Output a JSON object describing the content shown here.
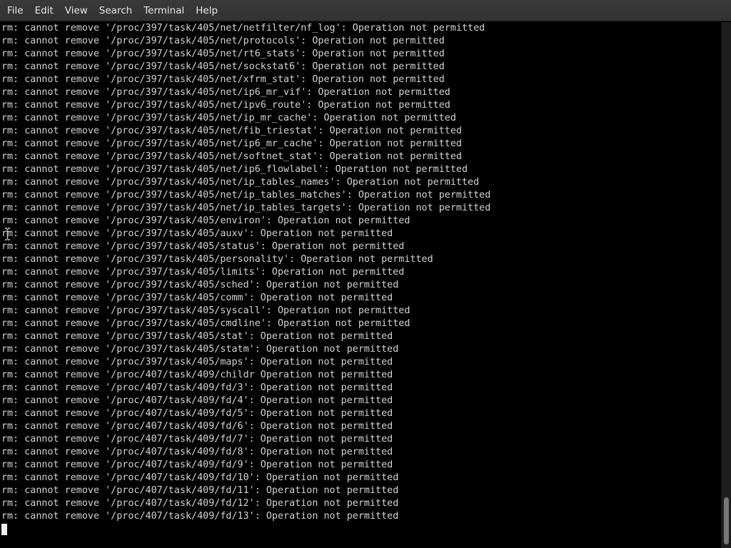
{
  "menubar": {
    "items": [
      {
        "label": "File"
      },
      {
        "label": "Edit"
      },
      {
        "label": "View"
      },
      {
        "label": "Search"
      },
      {
        "label": "Terminal"
      },
      {
        "label": "Help"
      }
    ]
  },
  "terminal": {
    "lines": [
      "rm: cannot remove '/proc/397/task/405/net/netfilter/nf_log': Operation not permitted",
      "rm: cannot remove '/proc/397/task/405/net/protocols': Operation not permitted",
      "rm: cannot remove '/proc/397/task/405/net/rt6_stats': Operation not permitted",
      "rm: cannot remove '/proc/397/task/405/net/sockstat6': Operation not permitted",
      "rm: cannot remove '/proc/397/task/405/net/xfrm_stat': Operation not permitted",
      "rm: cannot remove '/proc/397/task/405/net/ip6_mr_vif': Operation not permitted",
      "rm: cannot remove '/proc/397/task/405/net/ipv6_route': Operation not permitted",
      "rm: cannot remove '/proc/397/task/405/net/ip_mr_cache': Operation not permitted",
      "rm: cannot remove '/proc/397/task/405/net/fib_triestat': Operation not permitted",
      "rm: cannot remove '/proc/397/task/405/net/ip6_mr_cache': Operation not permitted",
      "rm: cannot remove '/proc/397/task/405/net/softnet_stat': Operation not permitted",
      "rm: cannot remove '/proc/397/task/405/net/ip6_flowlabel': Operation not permitted",
      "rm: cannot remove '/proc/397/task/405/net/ip_tables_names': Operation not permitted",
      "rm: cannot remove '/proc/397/task/405/net/ip_tables_matches': Operation not permitted",
      "rm: cannot remove '/proc/397/task/405/net/ip_tables_targets': Operation not permitted",
      "rm: cannot remove '/proc/397/task/405/environ': Operation not permitted",
      "rm: cannot remove '/proc/397/task/405/auxv': Operation not permitted",
      "rm: cannot remove '/proc/397/task/405/status': Operation not permitted",
      "rm: cannot remove '/proc/397/task/405/personality': Operation not permitted",
      "rm: cannot remove '/proc/397/task/405/limits': Operation not permitted",
      "rm: cannot remove '/proc/397/task/405/sched': Operation not permitted",
      "rm: cannot remove '/proc/397/task/405/comm': Operation not permitted",
      "rm: cannot remove '/proc/397/task/405/syscall': Operation not permitted",
      "rm: cannot remove '/proc/397/task/405/cmdline': Operation not permitted",
      "rm: cannot remove '/proc/397/task/405/stat': Operation not permitted",
      "rm: cannot remove '/proc/397/task/405/statm': Operation not permitted",
      "rm: cannot remove '/proc/397/task/405/maps': Operation not permitted",
      "rm: cannot remove '/proc/407/task/409/childr Operation not permitted",
      "rm: cannot remove '/proc/407/task/409/fd/3': Operation not permitted",
      "rm: cannot remove '/proc/407/task/409/fd/4': Operation not permitted",
      "rm: cannot remove '/proc/407/task/409/fd/5': Operation not permitted",
      "rm: cannot remove '/proc/407/task/409/fd/6': Operation not permitted",
      "rm: cannot remove '/proc/407/task/409/fd/7': Operation not permitted",
      "rm: cannot remove '/proc/407/task/409/fd/8': Operation not permitted",
      "rm: cannot remove '/proc/407/task/409/fd/9': Operation not permitted",
      "rm: cannot remove '/proc/407/task/409/fd/10': Operation not permitted",
      "rm: cannot remove '/proc/407/task/409/fd/11': Operation not permitted",
      "rm: cannot remove '/proc/407/task/409/fd/12': Operation not permitted",
      "rm: cannot remove '/proc/407/task/409/fd/13': Operation not permitted"
    ]
  },
  "icons": {
    "mouse_cursor": "ibeam-icon",
    "text_cursor": "cursor-block"
  },
  "colors": {
    "terminal_bg": "#000000",
    "terminal_fg": "#d3d3d3",
    "menubar_bg": "#363636",
    "menubar_fg": "#e6e6e6"
  }
}
